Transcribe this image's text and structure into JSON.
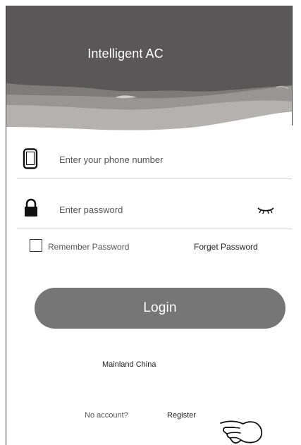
{
  "app": {
    "title": "Intelligent AC"
  },
  "form": {
    "phone": {
      "placeholder": "Enter your phone number",
      "value": "",
      "icon": "phone-icon"
    },
    "password": {
      "placeholder": "Enter password",
      "value": "",
      "icon": "lock-icon",
      "toggle_icon": "eye-closed-icon"
    },
    "remember": {
      "label": "Remember Password",
      "checked": false
    },
    "forget_label": "Forget Password",
    "login_label": "Login"
  },
  "region": {
    "label": "Mainland China"
  },
  "footer": {
    "prompt": "No account?",
    "register_label": "Register",
    "pointer_icon": "pointing-hand-icon"
  },
  "colors": {
    "header_dark": "#595757",
    "wave_light": "#b4b1b0",
    "wave_mid": "#8f8b89",
    "button": "#767676",
    "divider": "#d9d9d9"
  }
}
